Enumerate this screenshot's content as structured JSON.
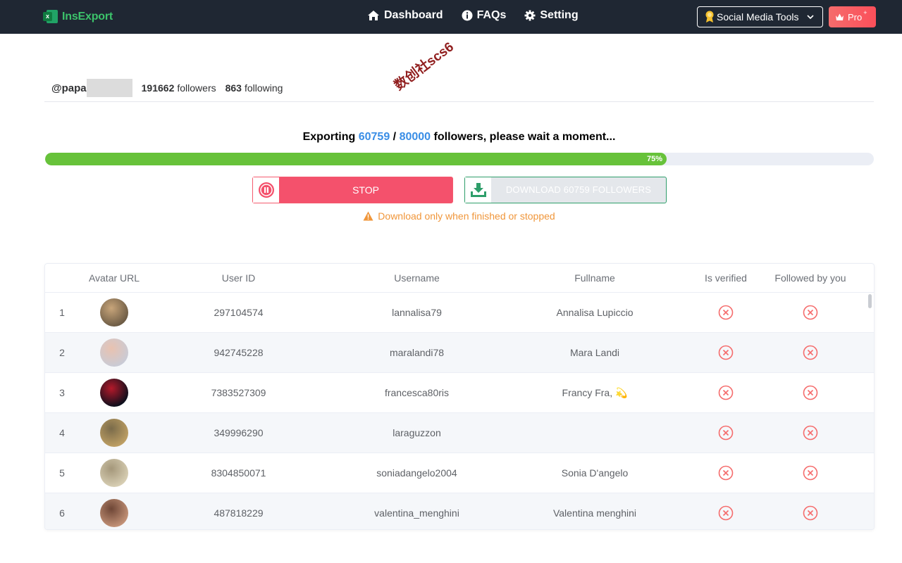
{
  "nav": {
    "brand": "InsExport",
    "links": [
      {
        "label": "Dashboard",
        "icon": "home-icon"
      },
      {
        "label": "FAQs",
        "icon": "info-icon"
      },
      {
        "label": "Setting",
        "icon": "gear-icon"
      }
    ],
    "tools_label": "Social Media Tools",
    "pro_label": "Pro",
    "pro_sup": "+"
  },
  "watermark": "数创社scs6",
  "profile": {
    "handle": "@papa",
    "followers_count": "191662",
    "followers_label": "followers",
    "following_count": "863",
    "following_label": "following"
  },
  "export": {
    "prefix": "Exporting",
    "done": "60759",
    "sep": "/",
    "total": "80000",
    "suffix": "followers, please wait a moment...",
    "progress_fraction": 0.75,
    "progress_label": "75%",
    "stop_label": "STOP",
    "download_label": "DOWNLOAD 60759 FOLLOWERS",
    "warning": "Download only when finished or stopped"
  },
  "table": {
    "columns": [
      "Avatar URL",
      "User ID",
      "Username",
      "Fullname",
      "Is verified",
      "Followed by you"
    ],
    "rows": [
      {
        "idx": "1",
        "user_id": "297104574",
        "username": "lannalisa79",
        "fullname": "Annalisa Lupiccio",
        "avatar_colors": [
          "#6b5a44",
          "#c8a57a"
        ]
      },
      {
        "idx": "2",
        "user_id": "942745228",
        "username": "maralandi78",
        "fullname": "Mara Landi",
        "avatar_colors": [
          "#c9cbd6",
          "#e9c2b0"
        ]
      },
      {
        "idx": "3",
        "user_id": "7383527309",
        "username": "francesca80ris",
        "fullname": "Francy Fra, 💫",
        "avatar_colors": [
          "#0a0f1c",
          "#b4192a"
        ]
      },
      {
        "idx": "4",
        "user_id": "349996290",
        "username": "laraguzzon",
        "fullname": "",
        "avatar_colors": [
          "#bfa064",
          "#7a6b4a"
        ]
      },
      {
        "idx": "5",
        "user_id": "8304850071",
        "username": "soniadangelo2004",
        "fullname": "Sonia D'angelo",
        "avatar_colors": [
          "#d8cfb4",
          "#a4977a"
        ]
      },
      {
        "idx": "6",
        "user_id": "487818229",
        "username": "valentina_menghini",
        "fullname": "Valentina menghini",
        "avatar_colors": [
          "#c49378",
          "#6e4636"
        ]
      }
    ]
  },
  "colors": {
    "nav_bg": "#1f2733",
    "brand": "#3cc36b",
    "accent_blue": "#3a8ee6",
    "progress": "#67c23a",
    "stop": "#f4516c",
    "warning": "#f0963a",
    "x_icon": "#f56c6c"
  }
}
